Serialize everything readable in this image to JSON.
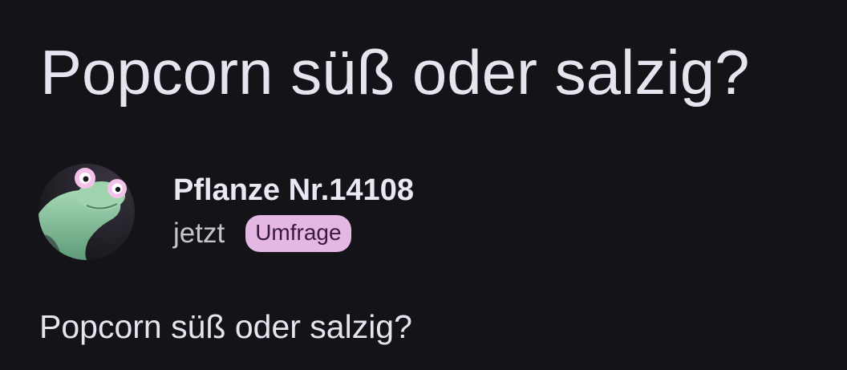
{
  "post": {
    "title": "Popcorn süß oder salzig?",
    "author": {
      "name": "Pflanze Nr.14108",
      "avatar_icon": "frog-avatar-icon"
    },
    "time": "jetzt",
    "badge": "Umfrage",
    "body": "Popcorn süß oder salzig?"
  },
  "colors": {
    "background": "#131318",
    "text": "#e7e4f0",
    "badge_bg": "#e5b8e3",
    "badge_text": "#3a1a3b"
  }
}
